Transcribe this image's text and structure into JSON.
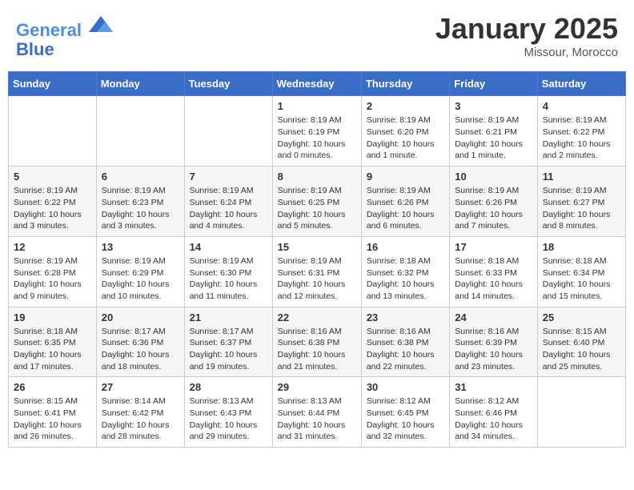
{
  "header": {
    "logo_line1": "General",
    "logo_line2": "Blue",
    "month": "January 2025",
    "location": "Missour, Morocco"
  },
  "days_of_week": [
    "Sunday",
    "Monday",
    "Tuesday",
    "Wednesday",
    "Thursday",
    "Friday",
    "Saturday"
  ],
  "weeks": [
    [
      {
        "day": "",
        "content": ""
      },
      {
        "day": "",
        "content": ""
      },
      {
        "day": "",
        "content": ""
      },
      {
        "day": "1",
        "content": "Sunrise: 8:19 AM\nSunset: 6:19 PM\nDaylight: 10 hours and 0 minutes."
      },
      {
        "day": "2",
        "content": "Sunrise: 8:19 AM\nSunset: 6:20 PM\nDaylight: 10 hours and 1 minute."
      },
      {
        "day": "3",
        "content": "Sunrise: 8:19 AM\nSunset: 6:21 PM\nDaylight: 10 hours and 1 minute."
      },
      {
        "day": "4",
        "content": "Sunrise: 8:19 AM\nSunset: 6:22 PM\nDaylight: 10 hours and 2 minutes."
      }
    ],
    [
      {
        "day": "5",
        "content": "Sunrise: 8:19 AM\nSunset: 6:22 PM\nDaylight: 10 hours and 3 minutes."
      },
      {
        "day": "6",
        "content": "Sunrise: 8:19 AM\nSunset: 6:23 PM\nDaylight: 10 hours and 3 minutes."
      },
      {
        "day": "7",
        "content": "Sunrise: 8:19 AM\nSunset: 6:24 PM\nDaylight: 10 hours and 4 minutes."
      },
      {
        "day": "8",
        "content": "Sunrise: 8:19 AM\nSunset: 6:25 PM\nDaylight: 10 hours and 5 minutes."
      },
      {
        "day": "9",
        "content": "Sunrise: 8:19 AM\nSunset: 6:26 PM\nDaylight: 10 hours and 6 minutes."
      },
      {
        "day": "10",
        "content": "Sunrise: 8:19 AM\nSunset: 6:26 PM\nDaylight: 10 hours and 7 minutes."
      },
      {
        "day": "11",
        "content": "Sunrise: 8:19 AM\nSunset: 6:27 PM\nDaylight: 10 hours and 8 minutes."
      }
    ],
    [
      {
        "day": "12",
        "content": "Sunrise: 8:19 AM\nSunset: 6:28 PM\nDaylight: 10 hours and 9 minutes."
      },
      {
        "day": "13",
        "content": "Sunrise: 8:19 AM\nSunset: 6:29 PM\nDaylight: 10 hours and 10 minutes."
      },
      {
        "day": "14",
        "content": "Sunrise: 8:19 AM\nSunset: 6:30 PM\nDaylight: 10 hours and 11 minutes."
      },
      {
        "day": "15",
        "content": "Sunrise: 8:19 AM\nSunset: 6:31 PM\nDaylight: 10 hours and 12 minutes."
      },
      {
        "day": "16",
        "content": "Sunrise: 8:18 AM\nSunset: 6:32 PM\nDaylight: 10 hours and 13 minutes."
      },
      {
        "day": "17",
        "content": "Sunrise: 8:18 AM\nSunset: 6:33 PM\nDaylight: 10 hours and 14 minutes."
      },
      {
        "day": "18",
        "content": "Sunrise: 8:18 AM\nSunset: 6:34 PM\nDaylight: 10 hours and 15 minutes."
      }
    ],
    [
      {
        "day": "19",
        "content": "Sunrise: 8:18 AM\nSunset: 6:35 PM\nDaylight: 10 hours and 17 minutes."
      },
      {
        "day": "20",
        "content": "Sunrise: 8:17 AM\nSunset: 6:36 PM\nDaylight: 10 hours and 18 minutes."
      },
      {
        "day": "21",
        "content": "Sunrise: 8:17 AM\nSunset: 6:37 PM\nDaylight: 10 hours and 19 minutes."
      },
      {
        "day": "22",
        "content": "Sunrise: 8:16 AM\nSunset: 6:38 PM\nDaylight: 10 hours and 21 minutes."
      },
      {
        "day": "23",
        "content": "Sunrise: 8:16 AM\nSunset: 6:38 PM\nDaylight: 10 hours and 22 minutes."
      },
      {
        "day": "24",
        "content": "Sunrise: 8:16 AM\nSunset: 6:39 PM\nDaylight: 10 hours and 23 minutes."
      },
      {
        "day": "25",
        "content": "Sunrise: 8:15 AM\nSunset: 6:40 PM\nDaylight: 10 hours and 25 minutes."
      }
    ],
    [
      {
        "day": "26",
        "content": "Sunrise: 8:15 AM\nSunset: 6:41 PM\nDaylight: 10 hours and 26 minutes."
      },
      {
        "day": "27",
        "content": "Sunrise: 8:14 AM\nSunset: 6:42 PM\nDaylight: 10 hours and 28 minutes."
      },
      {
        "day": "28",
        "content": "Sunrise: 8:13 AM\nSunset: 6:43 PM\nDaylight: 10 hours and 29 minutes."
      },
      {
        "day": "29",
        "content": "Sunrise: 8:13 AM\nSunset: 6:44 PM\nDaylight: 10 hours and 31 minutes."
      },
      {
        "day": "30",
        "content": "Sunrise: 8:12 AM\nSunset: 6:45 PM\nDaylight: 10 hours and 32 minutes."
      },
      {
        "day": "31",
        "content": "Sunrise: 8:12 AM\nSunset: 6:46 PM\nDaylight: 10 hours and 34 minutes."
      },
      {
        "day": "",
        "content": ""
      }
    ]
  ]
}
